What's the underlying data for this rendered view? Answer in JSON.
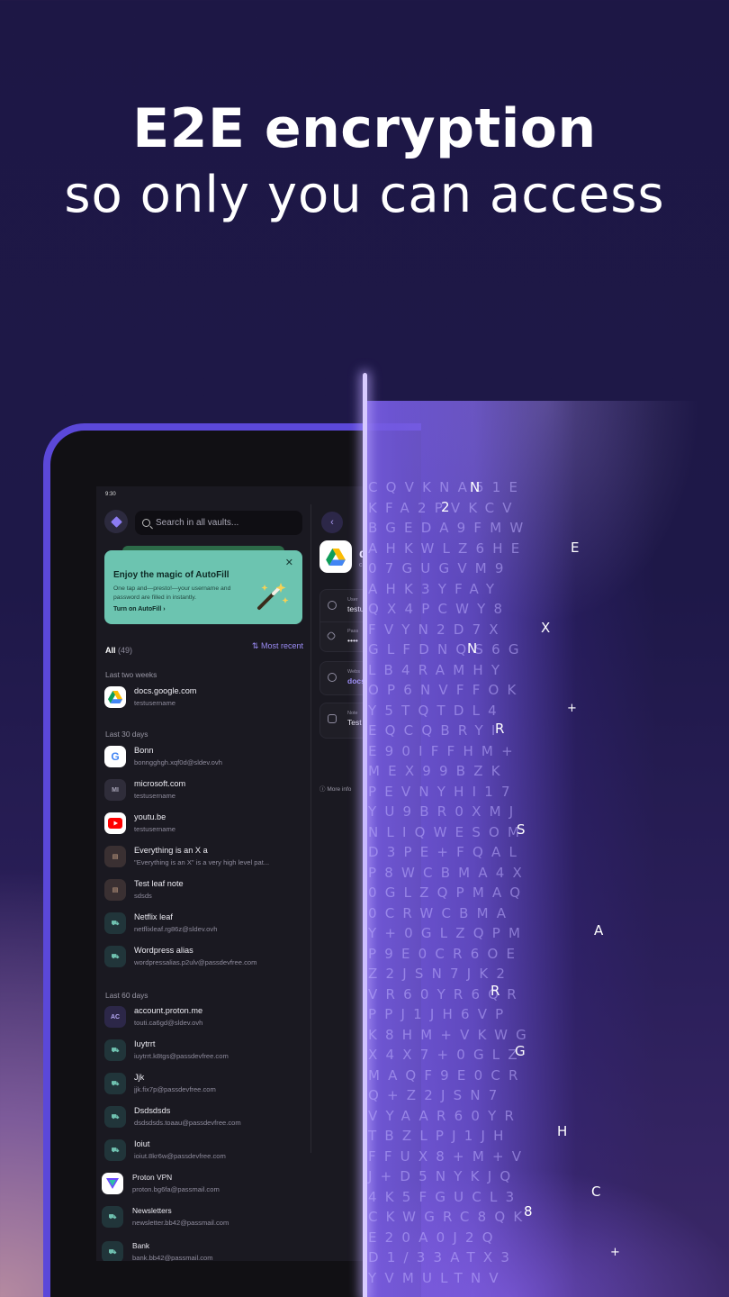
{
  "headline": {
    "line1": "E2E encryption",
    "line2": "so only you can access"
  },
  "status_time": "9:30",
  "search": {
    "placeholder": "Search in all vaults..."
  },
  "promo": {
    "title": "Enjoy the magic of AutoFill",
    "body": "One tap and—presto!—your username and password are filled in instantly.",
    "link": "Turn on AutoFill",
    "link_chevron": "›",
    "close": "✕"
  },
  "filter": {
    "all_label": "All",
    "all_count": "(49)",
    "sort_icon": "⇅",
    "sort_label": "Most recent"
  },
  "sections": {
    "s1": "Last two weeks",
    "s2": "Last 30 days",
    "s3": "Last 60 days"
  },
  "items": [
    {
      "title": "docs.google.com",
      "sub": "testusername",
      "icon": "google-drive-icon"
    },
    {
      "title": "Bonn",
      "sub": "bonngghgh.xqf0d@sldev.ovh",
      "icon": "google-icon",
      "glyph": "G"
    },
    {
      "title": "microsoft.com",
      "sub": "testusername",
      "icon": "initials-icon",
      "glyph": "MI"
    },
    {
      "title": "youtu.be",
      "sub": "testusername",
      "icon": "youtube-icon"
    },
    {
      "title": "Everything is an X a",
      "sub": "\"Everything is an X\" is a very high level pat...",
      "icon": "note-icon",
      "glyph": "▤"
    },
    {
      "title": "Test leaf note",
      "sub": "sdsds",
      "icon": "note-icon",
      "glyph": "▤"
    },
    {
      "title": "Netflix leaf",
      "sub": "netflixleaf.rg86z@sldev.ovh",
      "icon": "alias-icon",
      "glyph": "⛟"
    },
    {
      "title": "Wordpress alias",
      "sub": "wordpressalias.p2ulv@passdevfree.com",
      "icon": "alias-icon",
      "glyph": "⛟"
    },
    {
      "title": "account.proton.me",
      "sub": "touti.ca6gd@sldev.ovh",
      "icon": "initials-icon",
      "glyph": "AC"
    },
    {
      "title": "Iuytrrt",
      "sub": "iuytrrt.k8tgs@passdevfree.com",
      "icon": "alias-icon",
      "glyph": "⛟"
    },
    {
      "title": "Jjk",
      "sub": "jjk.fix7p@passdevfree.com",
      "icon": "alias-icon",
      "glyph": "⛟"
    },
    {
      "title": "Dsdsdsds",
      "sub": "dsdsdsds.toaau@passdevfree.com",
      "icon": "alias-icon",
      "glyph": "⛟"
    },
    {
      "title": "Ioiut",
      "sub": "ioiut.8kr6w@passdevfree.com",
      "icon": "alias-icon",
      "glyph": "⛟"
    },
    {
      "title": "Proton VPN",
      "sub": "proton.bg6fa@passmail.com",
      "icon": "proton-vpn-icon"
    },
    {
      "title": "Newsletters",
      "sub": "newsletter.bb42@passmail.com",
      "icon": "alias-icon",
      "glyph": "⛟"
    },
    {
      "title": "Bank",
      "sub": "bank.bb42@passmail.com",
      "icon": "alias-icon",
      "glyph": "⛟"
    }
  ],
  "detail": {
    "back": "‹",
    "title_initial": "d",
    "sub_initial": "c",
    "username_label": "User",
    "username_value": "testu",
    "password_label": "Pass",
    "password_value": "••••",
    "website_label": "Webs",
    "website_value": "docs",
    "note_label": "Note",
    "note_value": "Test",
    "more_info": "More info"
  },
  "cipher_rows": [
    "CQVKNA51E",
    "KFA2PVKCV",
    "BGEDA9FMW",
    "AHKWLZ6HE",
    "07GUGVM9",
    "AHK3YFAY",
    "QX4PCWY8",
    "FVYN2D7X",
    "GLFDNQS6G",
    "LB4RAMHY",
    "OP6NVFFOK",
    "Y5TQTDL4",
    "EQCQBRYI",
    "E90IFFHM+",
    "MEX99BZK",
    "PEVNYHI17",
    "YU9BR0XMJ",
    "NLIQWESOM",
    "D3PE+FQAL",
    "P8WCBMA4X",
    "0GLZQPMAQ",
    "0CRWCBMA",
    "Y+0GLZQPM",
    "P9E0CR6OE",
    "Z2JSN7JK2",
    "VR60YR6QR",
    "PPJ1JH6VP",
    "K8HM+VKWG",
    "X4X7+0GLZ",
    "MAQF9E0CR",
    "Q+Z2JSN7",
    "VYAAR60YR",
    "TBZLPJ1JH",
    "FFUX8+M+V",
    "J+D5NYKJQ",
    "4K5FGUCL3",
    "CKWGRC8QK",
    "E20A0J2Q",
    "D1/33ATX3",
    "YVMULTNV"
  ],
  "cipher_bright": [
    "N",
    "2",
    "E",
    "X",
    "N",
    "R",
    "S",
    "A",
    "R",
    "G",
    "H",
    "C",
    "8",
    "+",
    "+"
  ]
}
